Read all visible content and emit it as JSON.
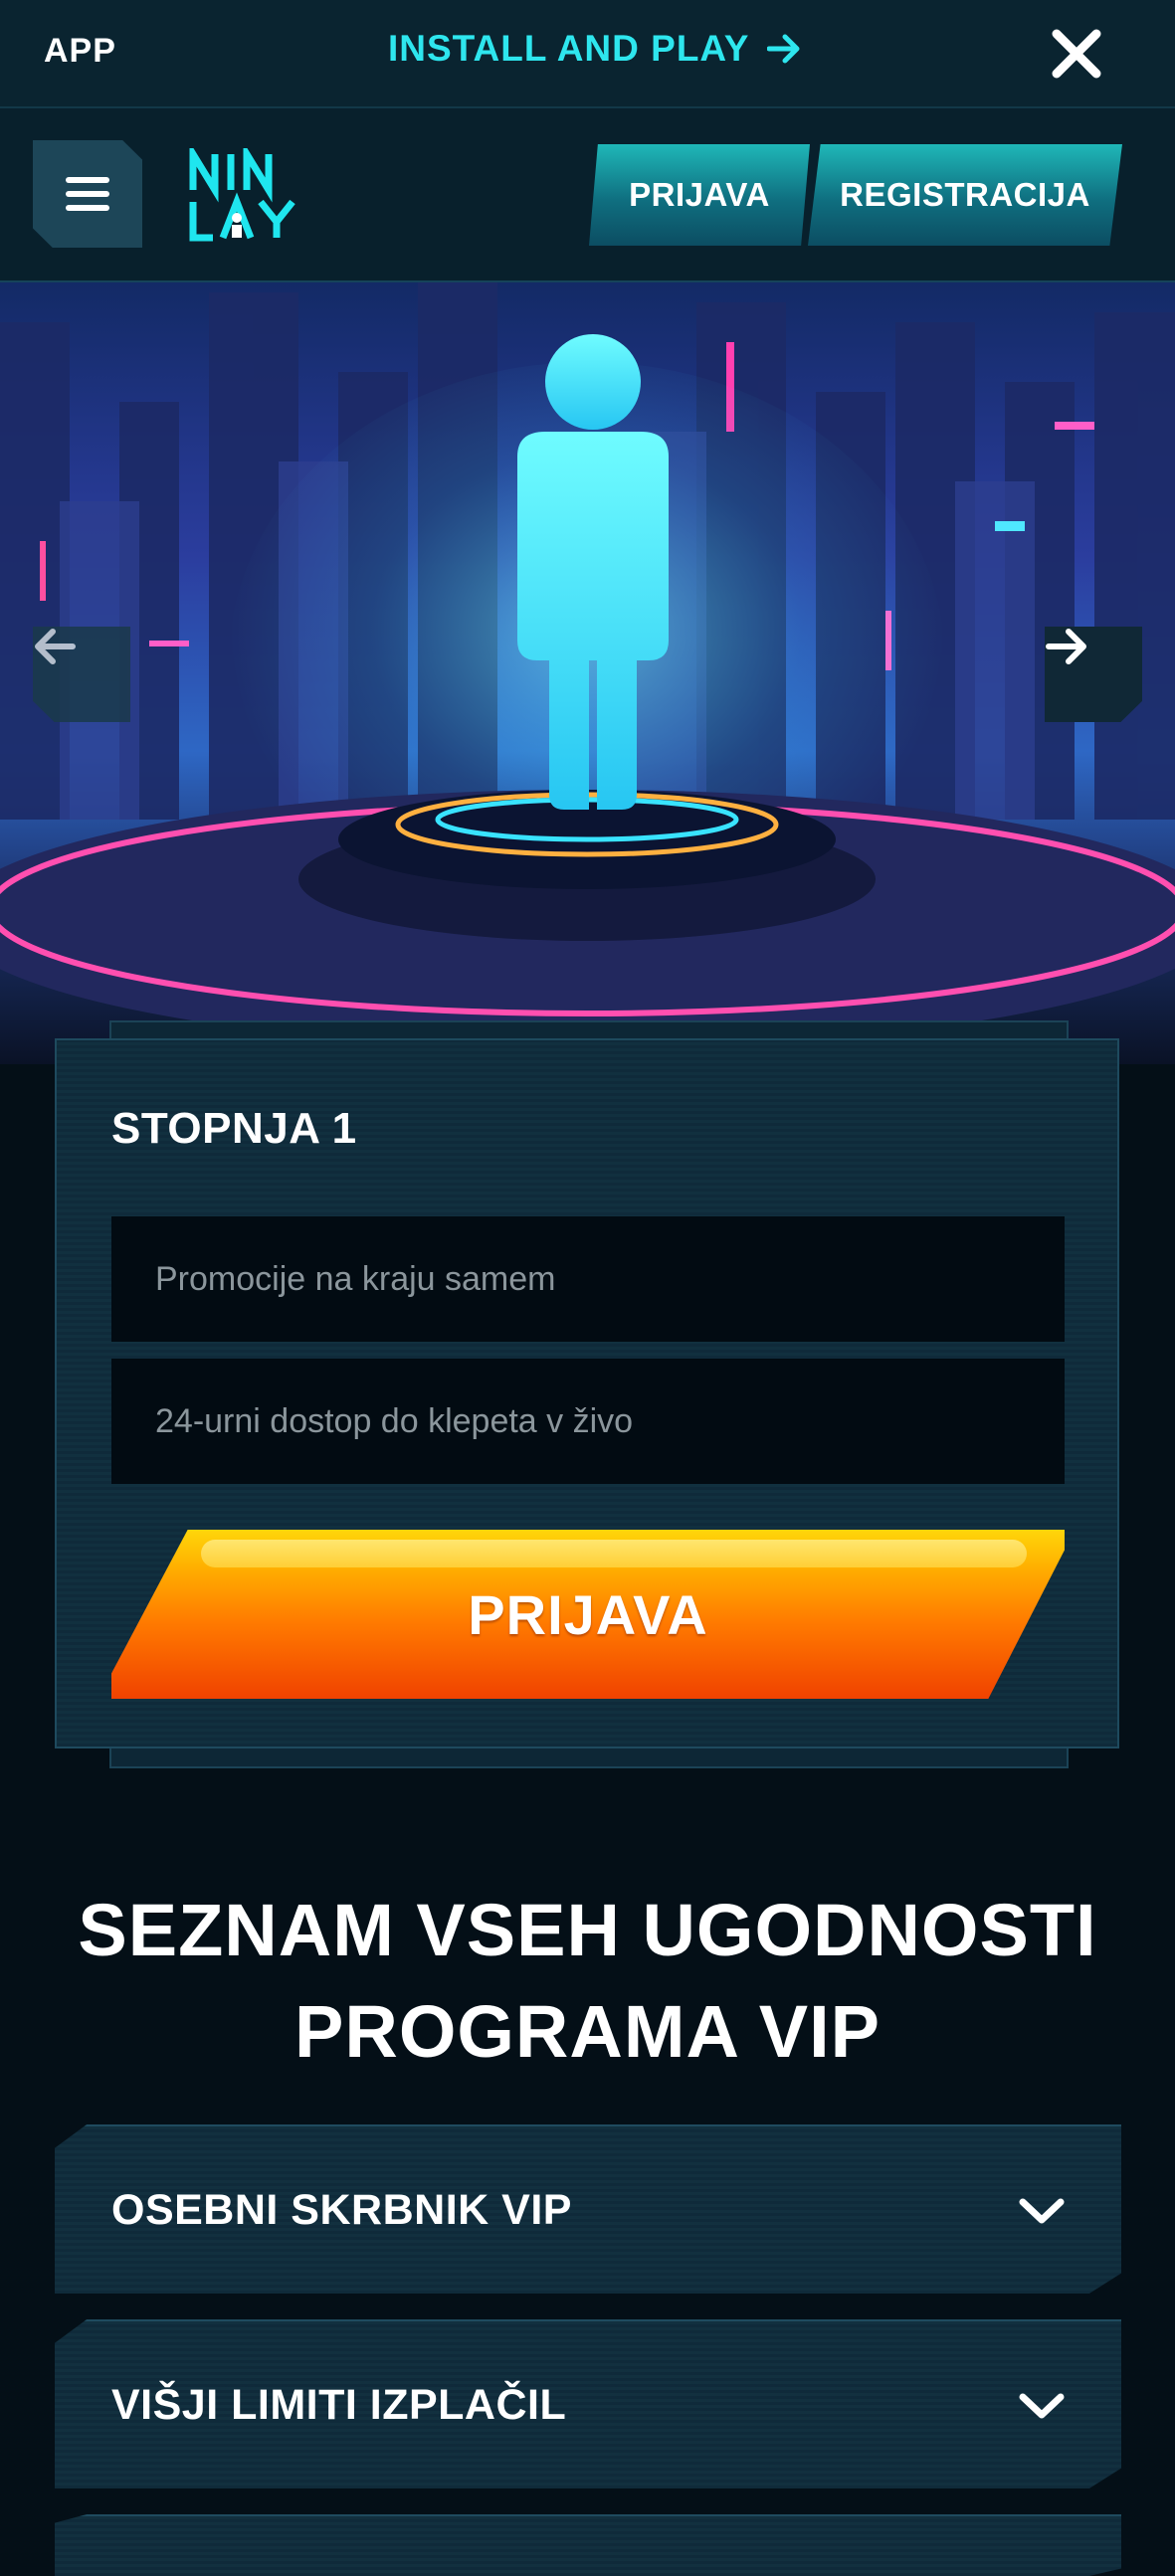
{
  "app_banner": {
    "app_label": "APP",
    "install_text": "INSTALL AND PLAY",
    "install_icon": "arrow-right-icon",
    "close_icon": "close-icon"
  },
  "header": {
    "menu_icon": "hamburger-menu-icon",
    "logo_text": "NIN LAY",
    "login_label": "PRIJAVA",
    "register_label": "REGISTRACIJA"
  },
  "hero": {
    "prev_icon": "arrow-left-icon",
    "next_icon": "arrow-right-icon"
  },
  "level_card": {
    "title": "STOPNJA 1",
    "perks": [
      "Promocije na kraju samem",
      "24-urni dostop do klepeta v živo"
    ],
    "cta_label": "PRIJAVA"
  },
  "benefits": {
    "title_line1": "SEZNAM VSEH UGODNOSTI",
    "title_line2": "PROGRAMA VIP",
    "items": [
      "OSEBNI SKRBNIK VIP",
      "VIŠJI LIMITI IZPLAČIL"
    ]
  },
  "colors": {
    "accent_cyan": "#2ee6ee",
    "cta_orange": "#ff7a00",
    "background": "#040f17"
  }
}
